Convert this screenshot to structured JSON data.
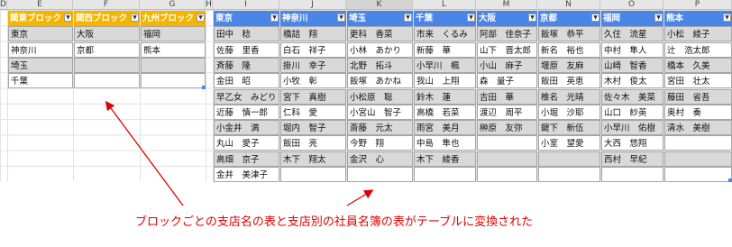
{
  "columns": [
    "D",
    "E",
    "F",
    "G",
    "H",
    "I",
    "J",
    "K",
    "L",
    "M",
    "N",
    "O",
    "P"
  ],
  "selected_column": "K",
  "block_table": {
    "headers": [
      "関東ブロック",
      "関西ブロック",
      "九州ブロック"
    ],
    "rows": [
      [
        "東京",
        "大阪",
        "福岡"
      ],
      [
        "神奈川",
        "京都",
        "熊本"
      ],
      [
        "埼玉",
        "",
        ""
      ],
      [
        "千葉",
        "",
        ""
      ]
    ]
  },
  "branch_table": {
    "headers": [
      "東京",
      "神奈川",
      "埼玉",
      "千葉",
      "大阪",
      "京都",
      "福岡",
      "熊本"
    ],
    "rows": [
      [
        "田中　稔",
        "橋詰　翔",
        "更科　香菜",
        "市来　くるみ",
        "阿部　佳奈子",
        "飯塚　恭平",
        "久住　流星",
        "小松　綾子"
      ],
      [
        "佐藤　里香",
        "白石　祥子",
        "小林　あかり",
        "新藤　華",
        "山下　晋太郎",
        "新名　裕也",
        "中村　隼人",
        "辻　浩太郎"
      ],
      [
        "斉藤　隆",
        "掛川　幸子",
        "北野　拓斗",
        "小早川　楓",
        "小山　麻子",
        "堰原　友麻",
        "山崎　智香",
        "橋本　久美"
      ],
      [
        "金田　昭",
        "小牧　彰",
        "飯塚　あかね",
        "我山　上翔",
        "森　量子",
        "飯田　英恵",
        "木村　俊太",
        "宮田　壮太"
      ],
      [
        "早乙女　みどり",
        "宮下　真樹",
        "小松原　聡",
        "鈴木　蓮",
        "吉田　華",
        "椎名　光晴",
        "佐々木　美菜",
        "藤田　省吾"
      ],
      [
        "近藤　慎一郎",
        "仁科　愛",
        "小宮山　智子",
        "高橋　若菜",
        "渡辺　周平",
        "小堀　沙耶",
        "山口　紗英",
        "奥村　奏"
      ],
      [
        "小金井　満",
        "堀内　智子",
        "斎藤　元太",
        "雨宮　美月",
        "榊原　友弥",
        "鍵下　新伍",
        "小早川　佑樹",
        "清水　美樹"
      ],
      [
        "丸山　愛子",
        "飯田　亮",
        "今野　翔",
        "中島　隼也",
        "",
        "小室　望愛",
        "大西　悠翔",
        ""
      ],
      [
        "高畑　京子",
        "木下　翔太",
        "金沢　心",
        "木下　綾香",
        "",
        "",
        "西村　早紀",
        ""
      ],
      [
        "金井　美津子",
        "",
        "",
        "",
        "",
        "",
        "",
        ""
      ]
    ]
  },
  "dropdown_glyph": "▼",
  "annotation": "ブロックごとの支店名の表と支店別の社員名簿の表がテーブルに変換された",
  "colors": {
    "block_header": "#f4b400",
    "branch_header": "#4a86e8",
    "arrow": "#e00000",
    "band": "#d9d9d9"
  }
}
